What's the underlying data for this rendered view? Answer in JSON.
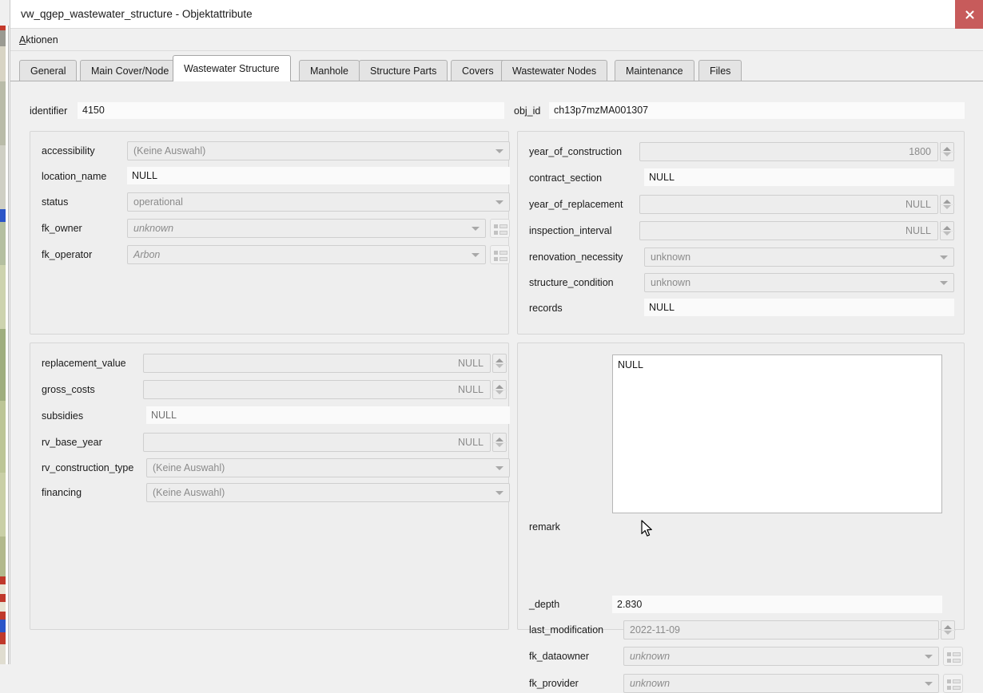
{
  "window": {
    "title": "vw_qgep_wastewater_structure - Objektattribute",
    "close_icon": "close-icon",
    "close_color": "#c75b5b"
  },
  "menubar": {
    "items": [
      {
        "label": "Aktionen",
        "mnemonic": "A",
        "rest": "ktionen"
      }
    ]
  },
  "tabs": [
    {
      "label": "General",
      "active": false
    },
    {
      "label": "Main Cover/Node",
      "active": false
    },
    {
      "label": "Wastewater Structure",
      "active": true
    },
    {
      "label": "Manhole",
      "active": false
    },
    {
      "label": "Structure Parts",
      "active": false
    },
    {
      "label": "Covers",
      "active": false
    },
    {
      "label": "Wastewater Nodes",
      "active": false
    },
    {
      "label": "Maintenance",
      "active": false
    },
    {
      "label": "Files",
      "active": false
    }
  ],
  "top_row": {
    "identifier": {
      "label": "identifier",
      "value": "4150"
    },
    "obj_id": {
      "label": "obj_id",
      "value": "ch13p7mzMA001307"
    }
  },
  "group_left_top": {
    "fields": [
      {
        "label": "accessibility",
        "type": "combo",
        "value": "(Keine Auswahl)",
        "italic": false,
        "has_relation_button": false
      },
      {
        "label": "location_name",
        "type": "line",
        "value": "NULL"
      },
      {
        "label": "status",
        "type": "combo",
        "value": "operational",
        "italic": false,
        "has_relation_button": false
      },
      {
        "label": "fk_owner",
        "type": "combo",
        "value": "unknown",
        "italic": true,
        "has_relation_button": true
      },
      {
        "label": "fk_operator",
        "type": "combo",
        "value": "Arbon",
        "italic": true,
        "has_relation_button": true
      }
    ]
  },
  "group_right_top": {
    "fields": [
      {
        "label": "year_of_construction",
        "type": "spin",
        "value": "1800"
      },
      {
        "label": "contract_section",
        "type": "line",
        "value": "NULL"
      },
      {
        "label": "year_of_replacement",
        "type": "spin",
        "value": "NULL"
      },
      {
        "label": "inspection_interval",
        "type": "spin",
        "value": "NULL"
      },
      {
        "label": "renovation_necessity",
        "type": "combo",
        "value": "unknown",
        "italic": false
      },
      {
        "label": "structure_condition",
        "type": "combo",
        "value": "unknown",
        "italic": false
      },
      {
        "label": "records",
        "type": "line",
        "value": "NULL"
      }
    ]
  },
  "group_left_bottom": {
    "fields": [
      {
        "label": "replacement_value",
        "type": "spin",
        "value": "NULL"
      },
      {
        "label": "gross_costs",
        "type": "spin",
        "value": "NULL"
      },
      {
        "label": "subsidies",
        "type": "line",
        "value": "NULL"
      },
      {
        "label": "rv_base_year",
        "type": "spin",
        "value": "NULL"
      },
      {
        "label": "rv_construction_type",
        "type": "combo",
        "value": "(Keine Auswahl)",
        "italic": false
      },
      {
        "label": "financing",
        "type": "combo",
        "value": "(Keine Auswahl)",
        "italic": false
      }
    ]
  },
  "group_right_bottom": {
    "remark": {
      "label": "remark",
      "value": "NULL"
    },
    "depth": {
      "label": "_depth",
      "value": "2.830"
    },
    "last_modification": {
      "label": "last_modification",
      "value": "2022-11-09"
    },
    "fk_dataowner": {
      "label": "fk_dataowner",
      "value": "unknown",
      "italic": true,
      "has_relation_button": true
    },
    "fk_provider": {
      "label": "fk_provider",
      "value": "unknown",
      "italic": true,
      "has_relation_button": true
    }
  }
}
